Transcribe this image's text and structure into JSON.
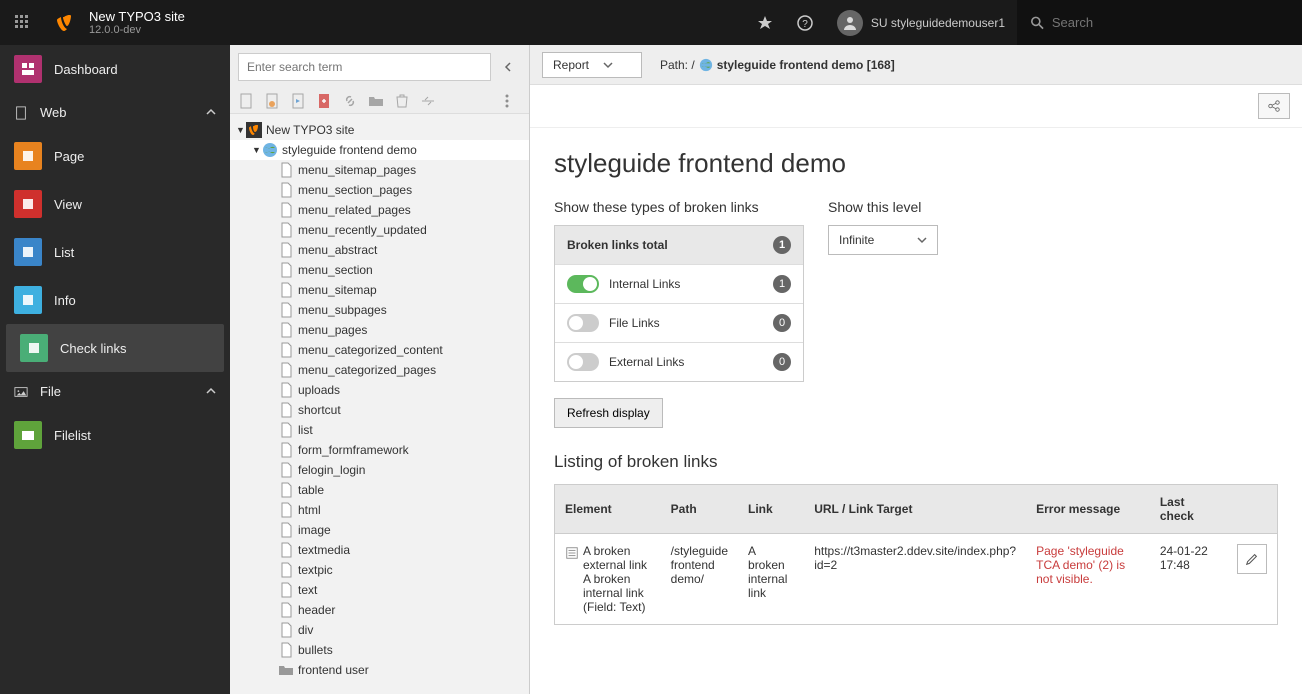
{
  "topbar": {
    "site_name": "New TYPO3 site",
    "version": "12.0.0-dev",
    "username": "SU styleguidedemouser1",
    "search_placeholder": "Search"
  },
  "module_menu": {
    "dashboard": "Dashboard",
    "web": "Web",
    "web_items": [
      {
        "label": "Page",
        "color": "c-orange"
      },
      {
        "label": "View",
        "color": "c-red"
      },
      {
        "label": "List",
        "color": "c-blue"
      },
      {
        "label": "Info",
        "color": "c-lblue"
      },
      {
        "label": "Check links",
        "color": "c-teal",
        "active": true
      }
    ],
    "file": "File",
    "file_items": [
      {
        "label": "Filelist",
        "color": "c-green"
      }
    ]
  },
  "page_tree": {
    "search_placeholder": "Enter search term",
    "root": "New TYPO3 site",
    "selected": "styleguide frontend demo",
    "pages": [
      "menu_sitemap_pages",
      "menu_section_pages",
      "menu_related_pages",
      "menu_recently_updated",
      "menu_abstract",
      "menu_section",
      "menu_sitemap",
      "menu_subpages",
      "menu_pages",
      "menu_categorized_content",
      "menu_categorized_pages",
      "uploads",
      "shortcut",
      "list",
      "form_formframework",
      "felogin_login",
      "table",
      "html",
      "image",
      "textmedia",
      "textpic",
      "text",
      "header",
      "div",
      "bullets",
      "frontend user"
    ]
  },
  "content": {
    "dropdown": "Report",
    "path_prefix": "Path: /",
    "path_page": "styleguide frontend demo [168]",
    "title": "styleguide frontend demo",
    "types_heading": "Show these types of broken links",
    "level_heading": "Show this level",
    "level_value": "Infinite",
    "total_label": "Broken links total",
    "total_count": "1",
    "link_types": [
      {
        "label": "Internal Links",
        "count": "1",
        "on": true
      },
      {
        "label": "File Links",
        "count": "0",
        "on": false
      },
      {
        "label": "External Links",
        "count": "0",
        "on": false
      }
    ],
    "refresh": "Refresh display",
    "listing_heading": "Listing of broken links",
    "columns": [
      "Element",
      "Path",
      "Link",
      "URL / Link Target",
      "Error message",
      "Last check"
    ],
    "row": {
      "element": "A broken external link A broken internal link (Field: Text)",
      "path": "/styleguide frontend demo/",
      "link": "A broken internal link",
      "url": "https://t3master2.ddev.site/index.php?id=2",
      "error": "Page 'styleguide TCA demo' (2) is not visible.",
      "lastcheck": "24-01-22 17:48"
    }
  }
}
